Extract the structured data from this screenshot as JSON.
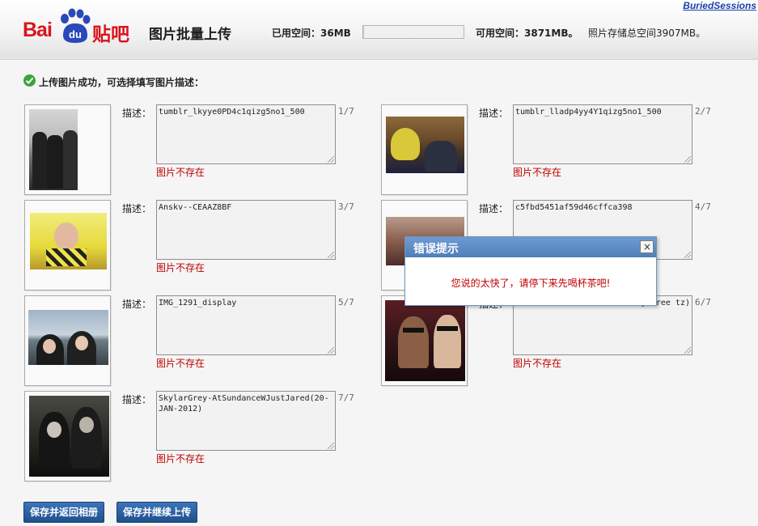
{
  "header": {
    "user_link": "BuriedSessions",
    "logo_text": "Bai",
    "logo_du": "du",
    "logo_tieba": "贴吧",
    "page_title": "图片批量上传",
    "used_space_label": "已用空间：36MB",
    "used_fraction": 0.01,
    "available_space_label": "可用空间：3871MB。",
    "total_space_label": "照片存储总空间3907MB。"
  },
  "success_message": "上传图片成功，可选择填写图片描述：",
  "items": [
    {
      "label": "描述：",
      "desc": "tumblr_lkyye0PD4c1qizg5no1_500",
      "counter": "1/7",
      "error": "图片不存在"
    },
    {
      "label": "描述：",
      "desc": "tumblr_lladp4yy4Y1qizg5no1_500",
      "counter": "2/7",
      "error": "图片不存在"
    },
    {
      "label": "描述：",
      "desc": "Anskv--CEAAZ8BF",
      "counter": "3/7",
      "error": "图片不存在"
    },
    {
      "label": "描述：",
      "desc": "c5fbd5451af59d46cffca398",
      "counter": "4/7",
      "error": ""
    },
    {
      "label": "描述：",
      "desc": "IMG_1291_display",
      "counter": "5/7",
      "error": "图片不存在"
    },
    {
      "label": "描述：",
      "desc": "…nyStree tz)",
      "counter": "6/7",
      "error": "图片不存在"
    },
    {
      "label": "描述：",
      "desc": "SkylarGrey-AtSundanceWJustJared(20-JAN-2012)",
      "counter": "7/7",
      "error": "图片不存在"
    }
  ],
  "dialog": {
    "title": "错误提示",
    "close_symbol": "×",
    "message": "您说的太快了，请停下来先喝杯茶吧!"
  },
  "buttons": {
    "save_return": "保存并返回相册",
    "save_continue": "保存并继续上传"
  },
  "colors": {
    "brand_red": "#d8141d",
    "brand_blue": "#2a48b8",
    "error_red": "#c00000",
    "button_blue": "#2a5fa2",
    "dialog_title_blue": "#5f8ec7"
  }
}
